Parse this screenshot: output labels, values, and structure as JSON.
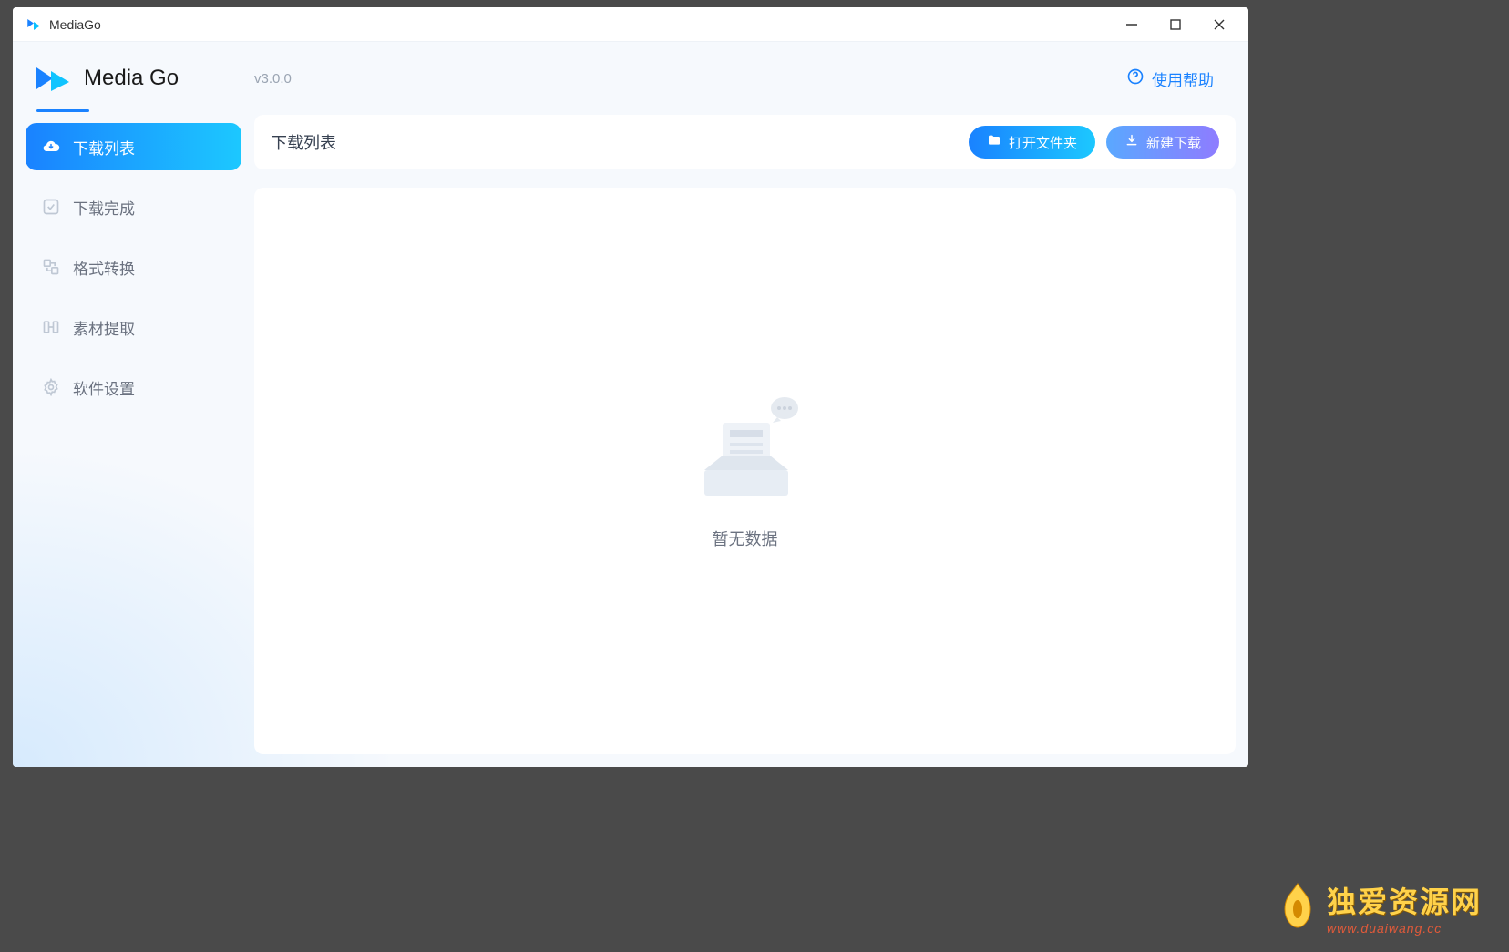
{
  "titlebar": {
    "title": "MediaGo"
  },
  "header": {
    "app_name": "Media Go",
    "version": "v3.0.0",
    "help_label": "使用帮助"
  },
  "sidebar": {
    "items": [
      {
        "label": "下载列表",
        "icon": "cloud-download"
      },
      {
        "label": "下载完成",
        "icon": "check-square"
      },
      {
        "label": "格式转换",
        "icon": "convert"
      },
      {
        "label": "素材提取",
        "icon": "extract"
      },
      {
        "label": "软件设置",
        "icon": "gear"
      }
    ]
  },
  "toolbar": {
    "title": "下载列表",
    "open_folder_label": "打开文件夹",
    "new_download_label": "新建下载"
  },
  "empty_state": {
    "text": "暂无数据"
  },
  "watermark": {
    "title": "独爱资源网",
    "url": "www.duaiwang.cc"
  }
}
